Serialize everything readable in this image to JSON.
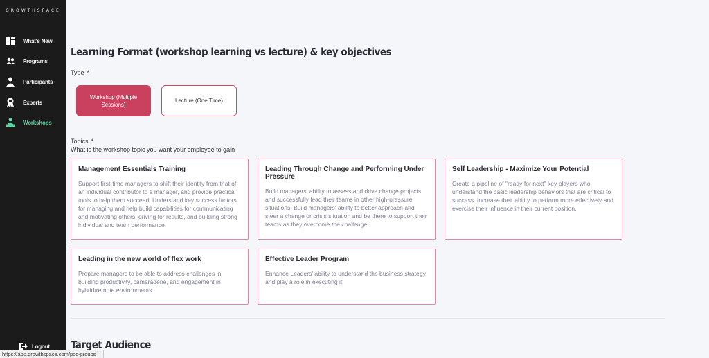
{
  "sidebar": {
    "brand": "GROWTHSPACE",
    "items": [
      {
        "label": "What's New",
        "icon": "dashboard-icon",
        "active": false
      },
      {
        "label": "Programs",
        "icon": "group-icon",
        "active": false
      },
      {
        "label": "Participants",
        "icon": "person-icon",
        "active": false
      },
      {
        "label": "Experts",
        "icon": "award-icon",
        "active": false
      },
      {
        "label": "Workshops",
        "icon": "workshop-icon",
        "active": true
      }
    ],
    "logout_label": "Logout",
    "active_color": "#5fd3a3"
  },
  "status_url": "https://app.growthspace.com/poc-groups",
  "main": {
    "section_title": "Learning Format (workshop learning vs lecture) & key objectives",
    "type": {
      "label": "Type",
      "required_mark": "*",
      "options": [
        {
          "label": "Workshop (Multiple Sessions)",
          "selected": true
        },
        {
          "label": "Lecture (One Time)",
          "selected": false
        }
      ]
    },
    "topics": {
      "label": "Topics",
      "required_mark": "*",
      "help": "What is the workshop topic you want your employee to gain",
      "cards": [
        {
          "title": "Management Essentials Training",
          "description": "Support first-time managers to shift their identity from that of an individual contributor to a manager, and provide practical tools to help them succeed. Understand key success factors for managing and help build capabilities for communicating and motivating others, driving for results, and building strong individual and team performance."
        },
        {
          "title": "Leading Through Change and Performing Under Pressure",
          "description": "Build managers' ability to assess and drive change projects and successfully lead their teams in other high-pressure situations. Build managers' ability to better approach and steer a change or crisis situation and be there to support their teams as they overcome the challenge."
        },
        {
          "title": "Self Leadership - Maximize Your Potential",
          "description": "Create a pipeline of \"ready for next\" key players who understand the basic leadership behaviors that are critical to success. Increase their ability to perform more effectively and exercise their influence in their current position."
        },
        {
          "title": "Leading in the new world of flex work",
          "description": "Prepare managers to be able to address challenges in building productivity, camaraderie, and engagement in hybrid/remote environments"
        },
        {
          "title": "Effective Leader Program",
          "description": "Enhance Leaders' ability to understand the business strategy and play a role in executing it"
        }
      ]
    },
    "next_section_title": "Target Audience",
    "accent_color": "#c9415f"
  }
}
